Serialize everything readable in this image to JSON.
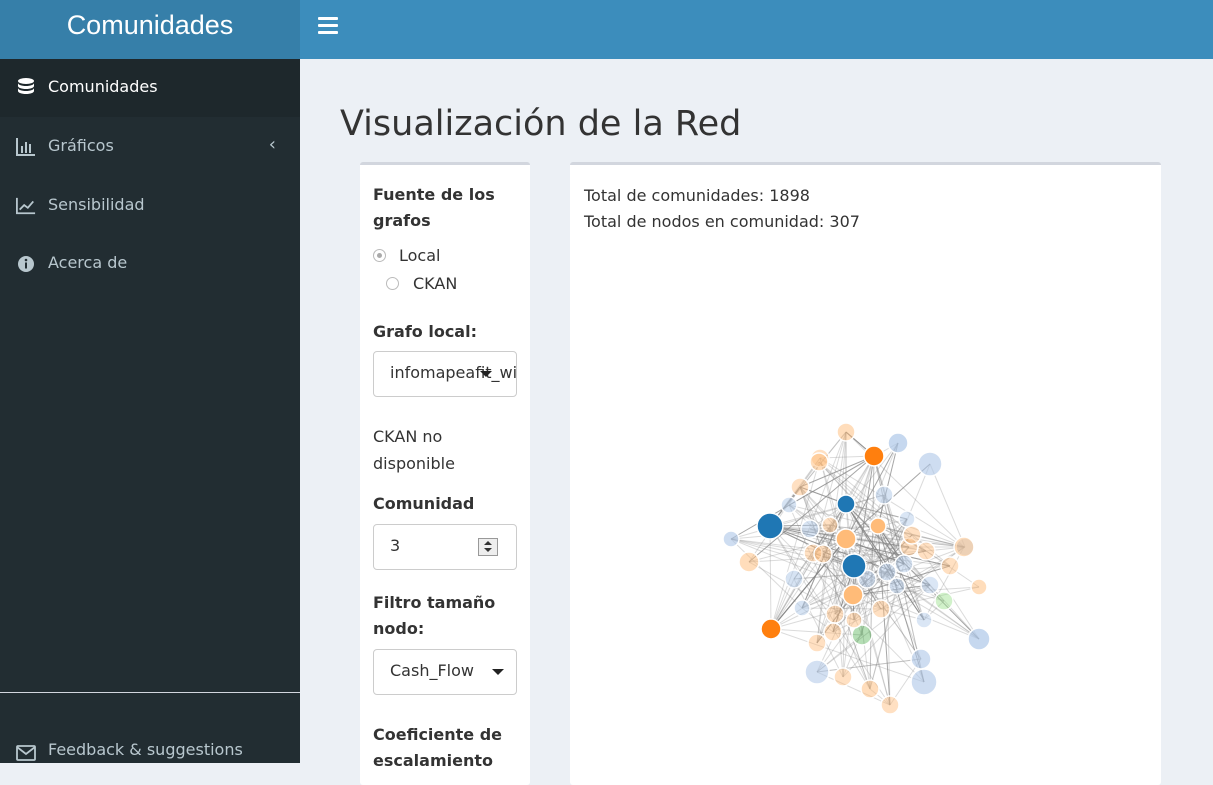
{
  "header": {
    "title": "Comunidades"
  },
  "sidebar": {
    "items": [
      {
        "label": "Comunidades",
        "icon": "database-icon",
        "active": true
      },
      {
        "label": "Gráficos",
        "icon": "bar-chart-icon",
        "has_submenu": true
      },
      {
        "label": "Sensibilidad",
        "icon": "line-chart-icon"
      },
      {
        "label": "Acerca de",
        "icon": "info-icon"
      }
    ],
    "footer_item": {
      "label": "Feedback & suggestions",
      "icon": "envelope-icon"
    }
  },
  "page": {
    "title": "Visualización de la Red"
  },
  "controls": {
    "source_label": "Fuente de los grafos",
    "source_options": [
      "Local",
      "CKAN"
    ],
    "source_selected": "Local",
    "local_graph_label": "Grafo local:",
    "local_graph_value": "infomapeafit_wi",
    "ckan_status": "CKAN no disponible",
    "community_label": "Comunidad",
    "community_value": "3",
    "size_filter_label": "Filtro tamaño nodo:",
    "size_filter_value": "Cash_Flow",
    "scaling_label": "Coeficiente de escalamiento"
  },
  "stats": {
    "total_communities": "Total de comunidades: 1898",
    "total_nodes": "Total de nodos en comunidad: 307"
  },
  "graph": {
    "colors": {
      "dark_blue": "#1f77b4",
      "orange": "#ff7f0e",
      "light_blue": "#aec7e8",
      "light_orange": "#ffbb78",
      "green": "#98df8a",
      "edge": "#888888"
    }
  }
}
